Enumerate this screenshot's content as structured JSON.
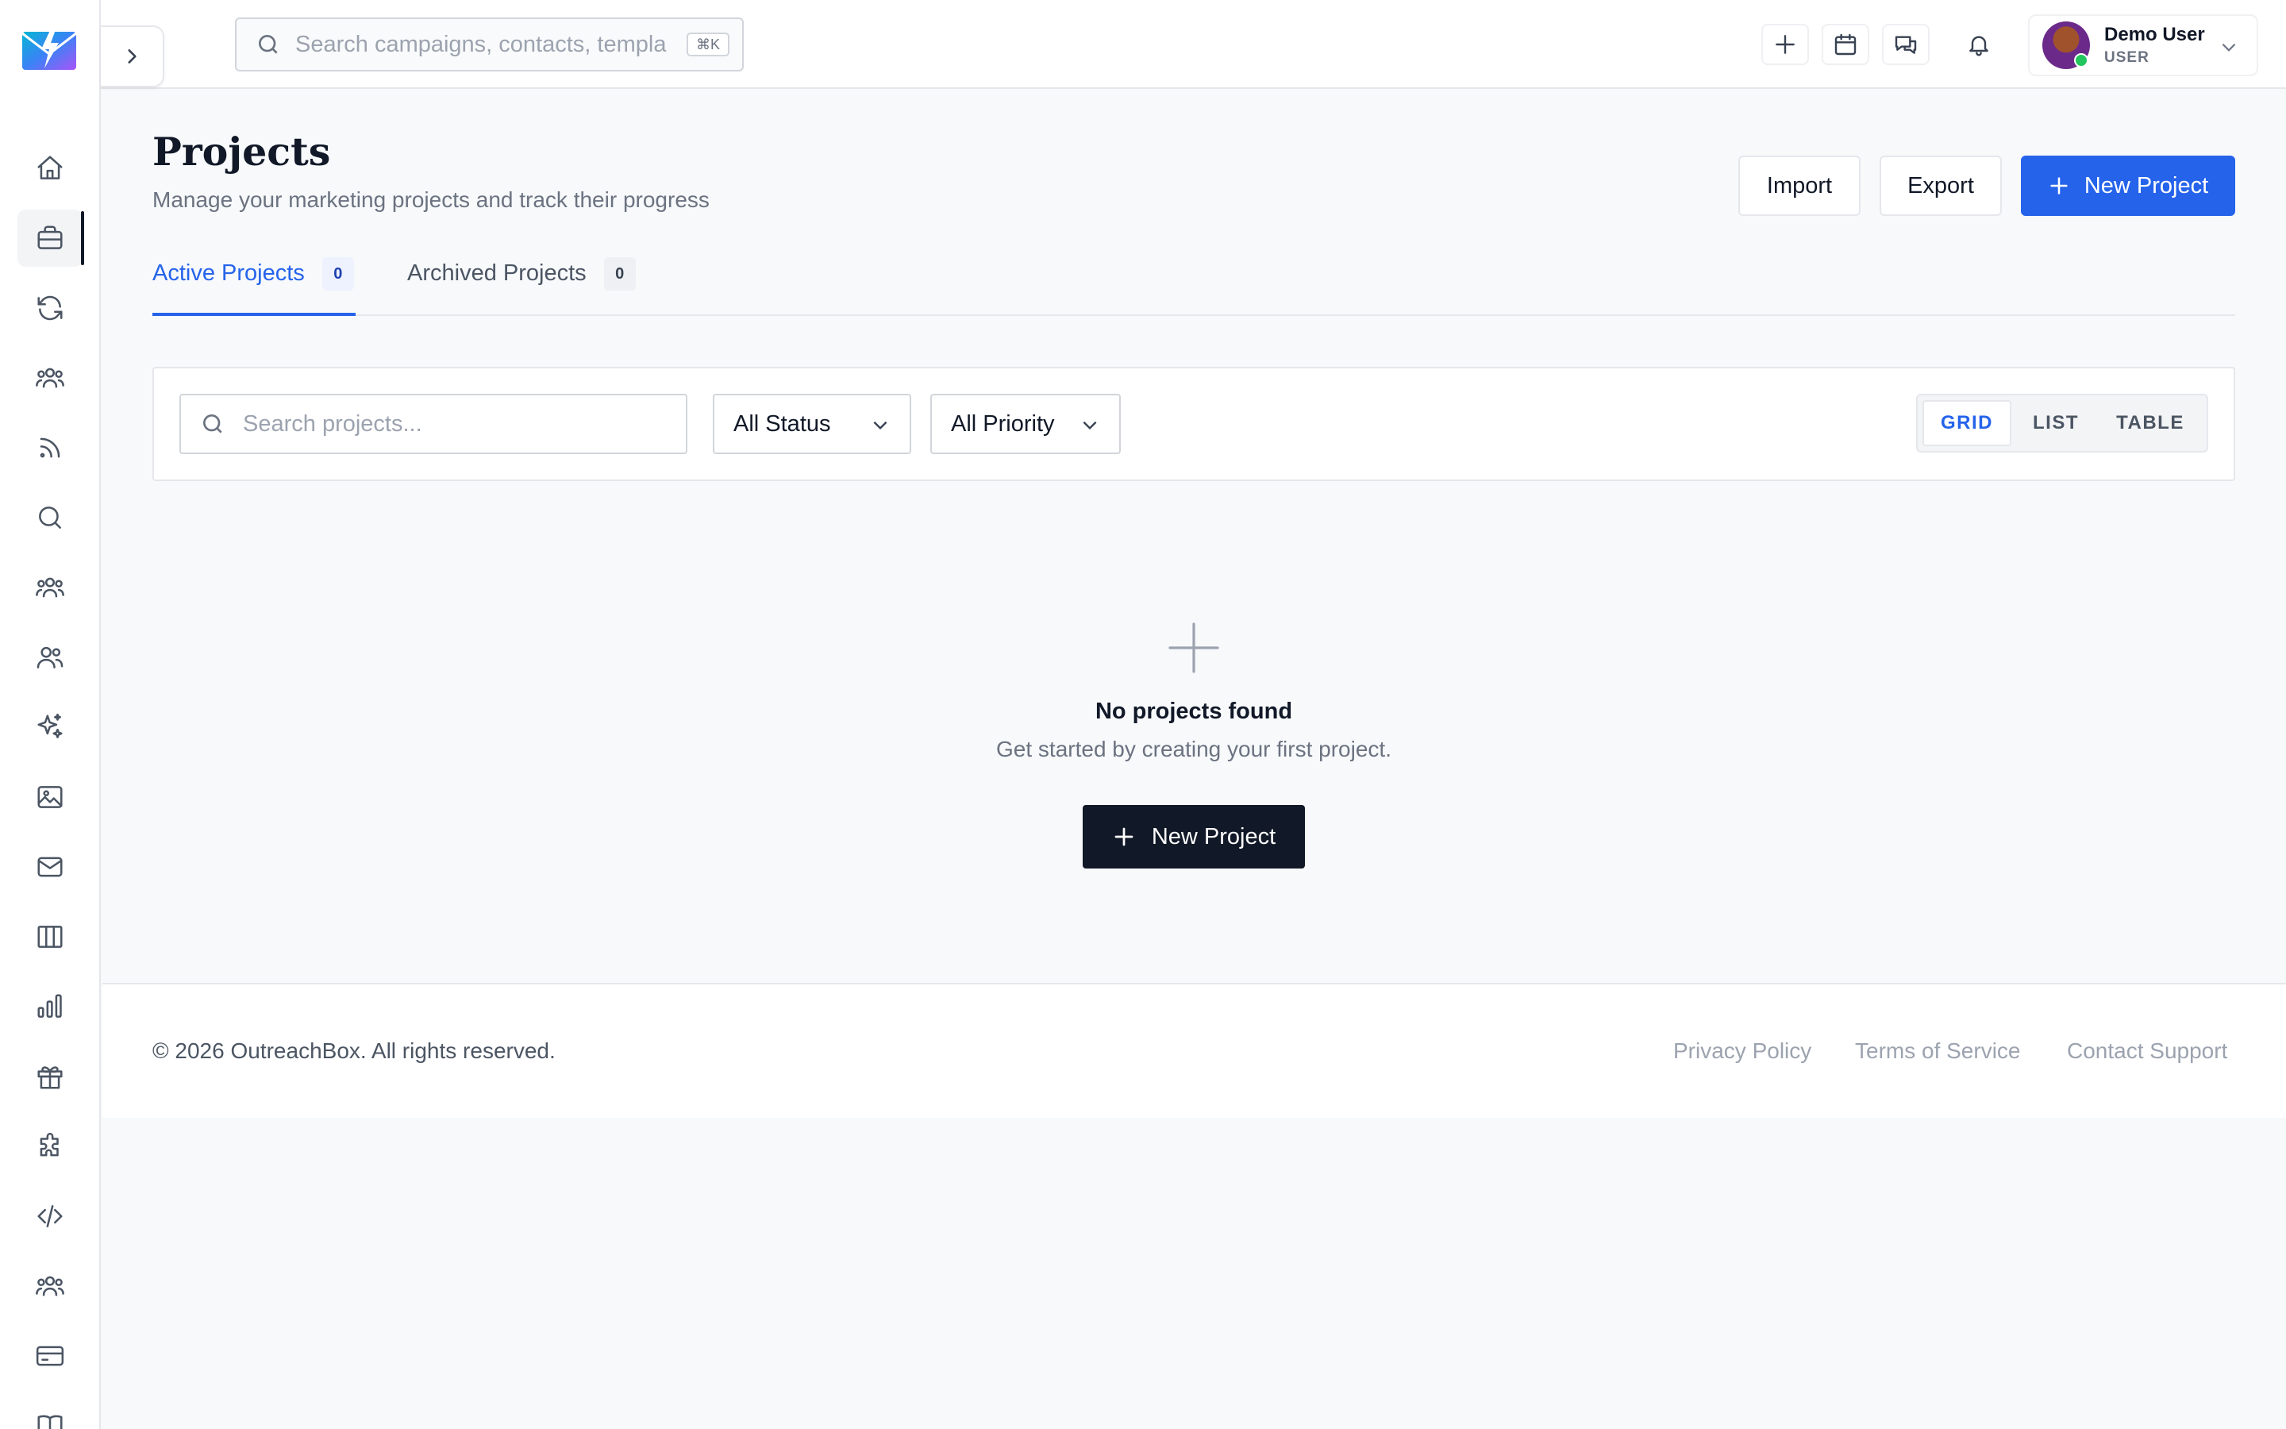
{
  "header": {
    "search_placeholder": "Search campaigns, contacts, templa",
    "shortcut": "⌘K",
    "user": {
      "name": "Demo User",
      "role": "USER"
    }
  },
  "sidebar": {
    "items": [
      {
        "name": "home",
        "icon": "home-icon",
        "active": false
      },
      {
        "name": "projects",
        "icon": "briefcase-icon",
        "active": true
      },
      {
        "name": "automations",
        "icon": "refresh-icon",
        "active": false
      },
      {
        "name": "audiences",
        "icon": "users-group-icon",
        "active": false
      },
      {
        "name": "feeds",
        "icon": "rss-icon",
        "active": false
      },
      {
        "name": "search",
        "icon": "search-icon",
        "active": false
      },
      {
        "name": "teams",
        "icon": "users-group-icon",
        "active": false
      },
      {
        "name": "contacts",
        "icon": "users-icon",
        "active": false
      },
      {
        "name": "ai",
        "icon": "sparkles-icon",
        "active": false
      },
      {
        "name": "media",
        "icon": "image-icon",
        "active": false
      },
      {
        "name": "email",
        "icon": "mail-icon",
        "active": false
      },
      {
        "name": "boards",
        "icon": "columns-icon",
        "active": false
      },
      {
        "name": "analytics",
        "icon": "bar-chart-icon",
        "active": false
      },
      {
        "name": "rewards",
        "icon": "gift-icon",
        "active": false
      },
      {
        "name": "integrations",
        "icon": "puzzle-icon",
        "active": false
      },
      {
        "name": "developer",
        "icon": "code-icon",
        "active": false
      },
      {
        "name": "community",
        "icon": "users-group-icon",
        "active": false
      },
      {
        "name": "billing",
        "icon": "credit-card-icon",
        "active": false
      },
      {
        "name": "docs",
        "icon": "book-icon",
        "active": false
      }
    ]
  },
  "page": {
    "title": "Projects",
    "subtitle": "Manage your marketing projects and track their progress",
    "import_label": "Import",
    "export_label": "Export",
    "new_project_label": "New Project"
  },
  "tabs": [
    {
      "label": "Active Projects",
      "count": "0"
    },
    {
      "label": "Archived Projects",
      "count": "0"
    }
  ],
  "filters": {
    "search_placeholder": "Search projects...",
    "status": "All Status",
    "priority": "All Priority",
    "views": [
      "GRID",
      "LIST",
      "TABLE"
    ]
  },
  "empty_state": {
    "title": "No projects found",
    "description": "Get started by creating your first project.",
    "button_label": "New Project"
  },
  "footer": {
    "copyright": "© 2026 OutreachBox. All rights reserved.",
    "links": [
      "Privacy Policy",
      "Terms of Service",
      "Contact Support"
    ]
  },
  "colors": {
    "accent": "#2563eb",
    "dark_button": "#111827",
    "background": "#f7f9fb"
  }
}
